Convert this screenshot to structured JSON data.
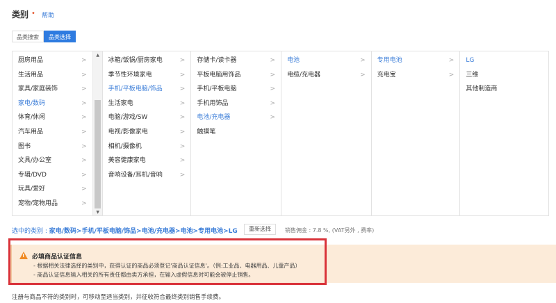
{
  "header": {
    "title": "类别",
    "required_mark": "•",
    "help": "帮助"
  },
  "tabs": [
    {
      "label": "品类搜索"
    },
    {
      "label": "品类选择"
    }
  ],
  "columns": [
    {
      "items": [
        "厨房用品",
        "生活用品",
        "家具/家庭装饰",
        "家电/数码",
        "体育/休闲",
        "汽车用品",
        "图书",
        "文具/办公室",
        "专辑/DVD",
        "玩具/爱好",
        "宠物/宠物用品"
      ],
      "selected": 3
    },
    {
      "items": [
        "冰箱/饭锅/厨房家电",
        "季节性环境家电",
        "手机/平板电脑/饰品",
        "生活家电",
        "电脑/游戏/SW",
        "电视/影像家电",
        "相机/摄像机",
        "美容健康家电",
        "音响设备/耳机/音响"
      ],
      "selected": 2
    },
    {
      "items": [
        "存储卡/读卡器",
        "平板电脑用饰品",
        "手机/平板电脑",
        "手机用饰品",
        "电池/充电器",
        "触摸笔"
      ],
      "selected": 4
    },
    {
      "items": [
        "电池",
        "电缆/充电器"
      ],
      "selected": 0
    },
    {
      "items": [
        "专用电池",
        "充电宝"
      ],
      "selected": 0
    },
    {
      "items": [
        "LG",
        "三维",
        "其他制造商"
      ],
      "selected": 0
    }
  ],
  "selection": {
    "label": "选中的类别 : ",
    "path": "家电/数码>手机/平板电脑/饰品>电池/充电器>电池>专用电池>LG",
    "reselect": "重新选择",
    "fee": "销售佣金 : 7.8 %, (VAT另外 , 费率)"
  },
  "alert": {
    "title": "必填商品认证信息",
    "lines": [
      "- 根据相关法律选择的类别中，获得认证的商品必须登记'商品认证信息'。（例:工业品、电器用品、儿童产品）",
      "- 商品认证信息输入相关的所有责任都由卖方承担，在输入虚假信息时可能会被停止销售。"
    ]
  },
  "footer": "注册与商品不符的类别时，可移动至适当类别，并征收符合最终类别销售手续费。"
}
